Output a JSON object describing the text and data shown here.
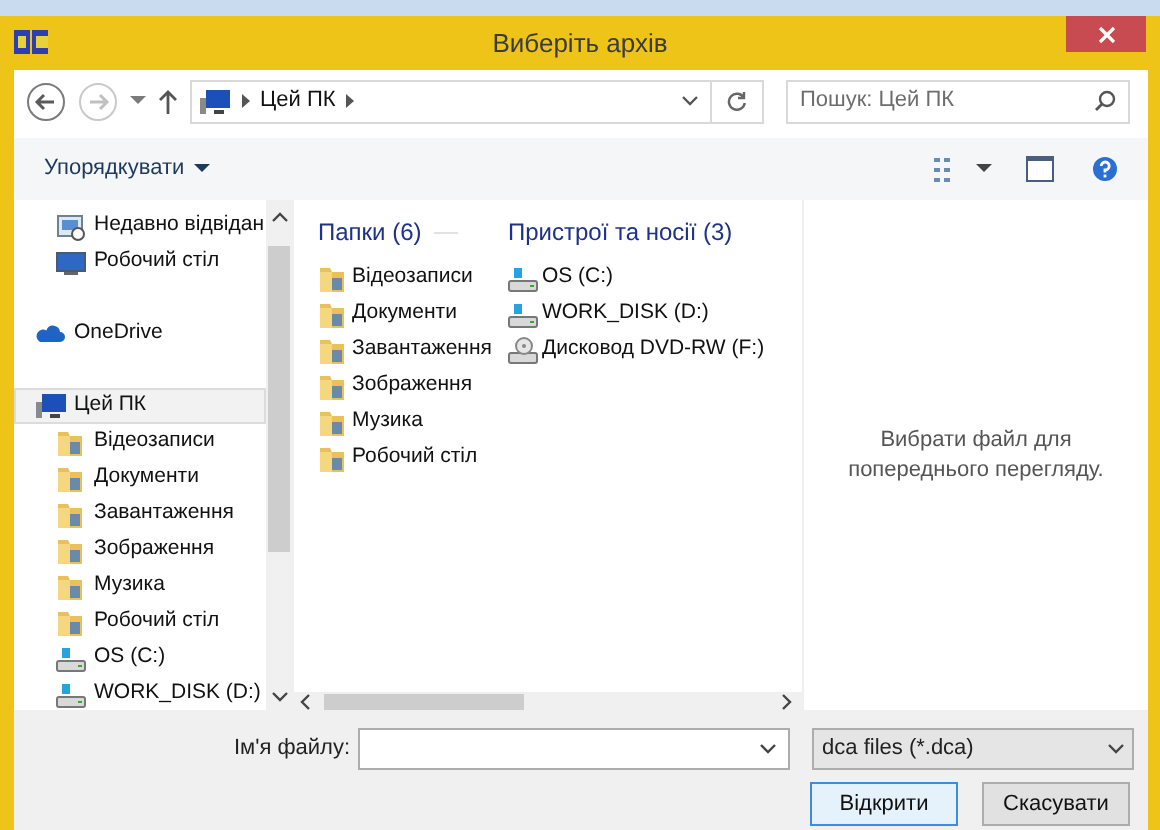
{
  "window": {
    "title": "Виберіть архів"
  },
  "nav": {
    "breadcrumb": [
      "Цей ПК"
    ],
    "search": {
      "placeholder": "Пошук: Цей ПК"
    }
  },
  "toolbar": {
    "organize": "Упорядкувати"
  },
  "sidebar": {
    "favorites": [
      {
        "label": "Недавно відвідан",
        "kind": "recent",
        "selected": false
      },
      {
        "label": "Робочий стіл",
        "kind": "desktop",
        "selected": false
      }
    ],
    "items": [
      {
        "label": "OneDrive",
        "kind": "cloud",
        "selected": false
      },
      {
        "label": "Цей ПК",
        "kind": "computer",
        "selected": true,
        "children": [
          {
            "label": "Відеозаписи",
            "kind": "folder",
            "selected": false
          },
          {
            "label": "Документи",
            "kind": "folder",
            "selected": false
          },
          {
            "label": "Завантаження",
            "kind": "folder",
            "selected": false
          },
          {
            "label": "Зображення",
            "kind": "folder",
            "selected": false
          },
          {
            "label": "Музика",
            "kind": "folder",
            "selected": false
          },
          {
            "label": "Робочий стіл",
            "kind": "folder",
            "selected": false
          },
          {
            "label": "OS (C:)",
            "kind": "drive",
            "selected": false
          },
          {
            "label": "WORK_DISK (D:)",
            "kind": "drive",
            "selected": false
          }
        ]
      }
    ]
  },
  "groups": [
    {
      "title": "Папки (6)",
      "items": [
        {
          "label": "Відеозаписи",
          "kind": "folder"
        },
        {
          "label": "Документи",
          "kind": "folder"
        },
        {
          "label": "Завантаження",
          "kind": "folder"
        },
        {
          "label": "Зображення",
          "kind": "folder"
        },
        {
          "label": "Музика",
          "kind": "folder"
        },
        {
          "label": "Робочий стіл",
          "kind": "folder"
        }
      ]
    },
    {
      "title": "Пристрої та носії (3)",
      "items": [
        {
          "label": "OS (C:)",
          "kind": "drive"
        },
        {
          "label": "WORK_DISK (D:)",
          "kind": "drive"
        },
        {
          "label": "Дисковод DVD-RW (F:)",
          "kind": "dvd"
        }
      ]
    }
  ],
  "preview": {
    "message": "Вибрати файл для попереднього перегляду."
  },
  "footer": {
    "filename_label": "Ім'я файлу:",
    "filter": "dca files (*.dca)",
    "buttons": [
      "Відкрити",
      "Скасувати"
    ]
  }
}
